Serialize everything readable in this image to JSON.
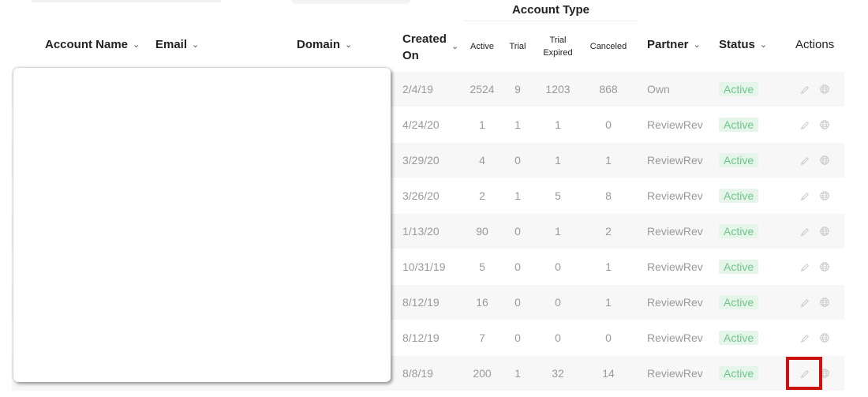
{
  "header": {
    "account_type_group": "Account Type",
    "columns": {
      "account_name": "Account Name",
      "email": "Email",
      "domain": "Domain",
      "created_on_line1": "Created",
      "created_on_line2": "On",
      "active": "Active",
      "trial": "Trial",
      "trial_expired_line1": "Trial",
      "trial_expired_line2": "Expired",
      "canceled": "Canceled",
      "partner": "Partner",
      "status": "Status",
      "actions": "Actions"
    },
    "sort_icon": "chevron-down-icon"
  },
  "rows": [
    {
      "created_on": "2/4/19",
      "active": "2524",
      "trial": "9",
      "trial_expired": "1203",
      "canceled": "868",
      "partner": "Own",
      "status": "Active"
    },
    {
      "created_on": "4/24/20",
      "active": "1",
      "trial": "1",
      "trial_expired": "1",
      "canceled": "0",
      "partner": "ReviewRev",
      "status": "Active"
    },
    {
      "created_on": "3/29/20",
      "active": "4",
      "trial": "0",
      "trial_expired": "1",
      "canceled": "1",
      "partner": "ReviewRev",
      "status": "Active"
    },
    {
      "created_on": "3/26/20",
      "active": "2",
      "trial": "1",
      "trial_expired": "5",
      "canceled": "8",
      "partner": "ReviewRev",
      "status": "Active"
    },
    {
      "created_on": "1/13/20",
      "active": "90",
      "trial": "0",
      "trial_expired": "1",
      "canceled": "2",
      "partner": "ReviewRev",
      "status": "Active"
    },
    {
      "created_on": "10/31/19",
      "active": "5",
      "trial": "0",
      "trial_expired": "0",
      "canceled": "1",
      "partner": "ReviewRev",
      "status": "Active"
    },
    {
      "created_on": "8/12/19",
      "active": "16",
      "trial": "0",
      "trial_expired": "0",
      "canceled": "1",
      "partner": "ReviewRev",
      "status": "Active"
    },
    {
      "created_on": "8/12/19",
      "active": "7",
      "trial": "0",
      "trial_expired": "0",
      "canceled": "0",
      "partner": "ReviewRev",
      "status": "Active"
    },
    {
      "created_on": "8/8/19",
      "active": "200",
      "trial": "1",
      "trial_expired": "32",
      "canceled": "14",
      "partner": "ReviewRev",
      "status": "Active"
    }
  ],
  "row_actions": [
    "edit-pencil-icon",
    "globe-icon"
  ],
  "colors": {
    "status_text": "#6fc48a",
    "status_bg": "#e6f5ea",
    "cell_text": "#9a9a9a",
    "stripe": "#f7f7f7",
    "highlight": "#cc1111"
  }
}
